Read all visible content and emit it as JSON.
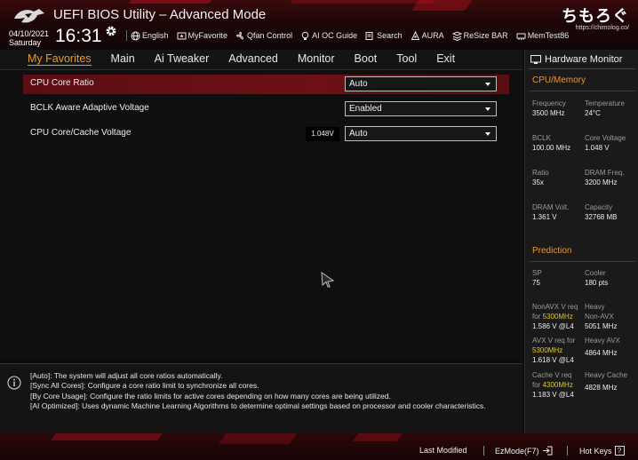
{
  "header": {
    "title": "UEFI BIOS Utility – Advanced Mode",
    "date": "04/10/2021",
    "weekday": "Saturday",
    "time": "16:31",
    "watermark": "ちもろぐ",
    "watermark_url": "https://chimolog.co/",
    "toolbar": [
      {
        "label": "English",
        "icon": "globe-icon"
      },
      {
        "label": "MyFavorite",
        "icon": "favorite-icon"
      },
      {
        "label": "Qfan Control",
        "icon": "fan-icon"
      },
      {
        "label": "AI OC Guide",
        "icon": "ai-bulb-icon"
      },
      {
        "label": "Search",
        "icon": "search-icon"
      },
      {
        "label": "AURA",
        "icon": "aura-icon"
      },
      {
        "label": "ReSize BAR",
        "icon": "resize-bar-icon"
      },
      {
        "label": "MemTest86",
        "icon": "memtest-icon"
      }
    ]
  },
  "nav": {
    "tabs": [
      "My Favorites",
      "Main",
      "Ai Tweaker",
      "Advanced",
      "Monitor",
      "Boot",
      "Tool",
      "Exit"
    ],
    "active": "My Favorites"
  },
  "settings": [
    {
      "label": "CPU Core Ratio",
      "value": "Auto",
      "selected": true
    },
    {
      "label": "BCLK Aware Adaptive Voltage",
      "value": "Enabled",
      "selected": false
    },
    {
      "label": "CPU Core/Cache Voltage",
      "value": "Auto",
      "readout": "1.048V",
      "selected": false
    }
  ],
  "help": {
    "lines": [
      "[Auto]: The system will adjust all core ratios automatically.",
      "[Sync All Cores]: Configure a core ratio limit to synchronize all cores.",
      "[By Core Usage]: Configure the ratio limits for active cores depending on how many cores are being utilized.",
      "[AI Optimized]: Uses dynamic Machine Learning Algorithms to determine optimal settings based on processor and cooler characteristics."
    ]
  },
  "hw_monitor": {
    "title": "Hardware Monitor",
    "cpu_memory": {
      "heading": "CPU/Memory",
      "cells": [
        {
          "label": "Frequency",
          "value": "3500 MHz"
        },
        {
          "label": "Temperature",
          "value": "24°C"
        },
        {
          "label": "BCLK",
          "value": "100.00 MHz"
        },
        {
          "label": "Core Voltage",
          "value": "1.048 V"
        },
        {
          "label": "Ratio",
          "value": "35x"
        },
        {
          "label": "DRAM Freq.",
          "value": "3200 MHz"
        },
        {
          "label": "DRAM Volt.",
          "value": "1.361 V"
        },
        {
          "label": "Capacity",
          "value": "32768 MB"
        }
      ]
    },
    "prediction": {
      "heading": "Prediction",
      "sp_label": "SP",
      "sp_value": "75",
      "cooler_label": "Cooler",
      "cooler_value": "180 pts",
      "nonavx_req": "NonAVX V req",
      "for": "for",
      "nonavx_freq": "5300MHz",
      "nonavx_value": "1.586 V @L4",
      "heavy_nonavx_label1": "Heavy",
      "heavy_nonavx_label2": "Non-AVX",
      "heavy_nonavx_value": "5051 MHz",
      "avx_req": "AVX V req",
      "avx_for": "for",
      "avx_freq": "5300MHz",
      "avx_value": "1.618 V @L4",
      "heavy_avx_label": "Heavy AVX",
      "heavy_avx_value": "4864 MHz",
      "cache_req": "Cache V req",
      "cache_for": "for",
      "cache_freq": "4300MHz",
      "cache_value": "1.183 V @L4",
      "heavy_cache_label": "Heavy Cache",
      "heavy_cache_value": "4828 MHz"
    }
  },
  "footer": {
    "last_modified": "Last Modified",
    "ezmode": "EzMode(F7)",
    "hotkeys": "Hot Keys",
    "hotkeys_key": "?"
  },
  "colors": {
    "accent": "#e89a2a",
    "selection": "#6e1016",
    "highlight": "#e3c623"
  }
}
